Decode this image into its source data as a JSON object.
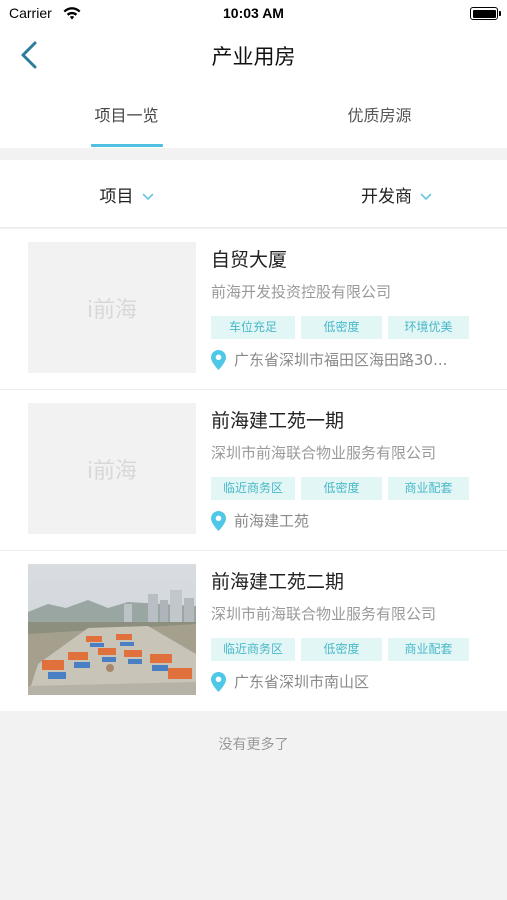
{
  "status": {
    "carrier": "Carrier",
    "time": "10:03 AM"
  },
  "nav": {
    "title": "产业用房"
  },
  "tabs": [
    {
      "label": "项目一览",
      "active": true
    },
    {
      "label": "优质房源",
      "active": false
    }
  ],
  "filters": [
    {
      "label": "项目"
    },
    {
      "label": "开发商"
    }
  ],
  "accent_color": "#4fc0e4",
  "tag_color": "#49b8c8",
  "items": [
    {
      "name": "自贸大厦",
      "company": "前海开发投资控股有限公司",
      "thumb_placeholder": "i前海",
      "tags": [
        "车位充足",
        "低密度",
        "环境优美"
      ],
      "address": "广东省深圳市福田区海田路30..."
    },
    {
      "name": "前海建工苑一期",
      "company": "深圳市前海联合物业服务有限公司",
      "thumb_placeholder": "i前海",
      "tags": [
        "临近商务区",
        "低密度",
        "商业配套"
      ],
      "address": "前海建工苑"
    },
    {
      "name": "前海建工苑二期",
      "company": "深圳市前海联合物业服务有限公司",
      "tags": [
        "临近商务区",
        "低密度",
        "商业配套"
      ],
      "address": "广东省深圳市南山区"
    }
  ],
  "footer": "没有更多了"
}
